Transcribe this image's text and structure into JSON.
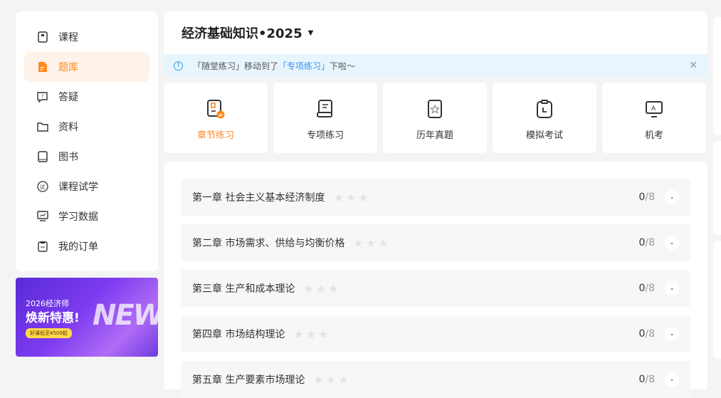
{
  "sidebar": {
    "items": [
      {
        "label": "课程",
        "icon": "book-icon"
      },
      {
        "label": "题库",
        "icon": "document-icon",
        "active": true
      },
      {
        "label": "答疑",
        "icon": "question-chat-icon"
      },
      {
        "label": "资料",
        "icon": "folder-icon"
      },
      {
        "label": "图书",
        "icon": "book-icon"
      },
      {
        "label": "课程试学",
        "icon": "trial-icon"
      },
      {
        "label": "学习数据",
        "icon": "monitor-chart-icon"
      },
      {
        "label": "我的订单",
        "icon": "clipboard-icon"
      }
    ]
  },
  "banner": {
    "line1": "2026经济师",
    "line2": "焕新特惠!",
    "badge": "好课低至¥500起",
    "art": "NEW"
  },
  "header": {
    "title": "经济基础知识•2025"
  },
  "notice": {
    "prefix": "「随堂练习」移动到了",
    "link": "「专项练习」",
    "suffix": "下啦～"
  },
  "tabs": [
    {
      "label": "章节练习",
      "active": true
    },
    {
      "label": "专项练习"
    },
    {
      "label": "历年真题"
    },
    {
      "label": "模拟考试"
    },
    {
      "label": "机考"
    }
  ],
  "chapters": [
    {
      "title": "第一章 社会主义基本经济制度",
      "done": "0",
      "total": "/8",
      "stars": 0
    },
    {
      "title": "第二章 市场需求、供给与均衡价格",
      "done": "0",
      "total": "/8",
      "stars": 0
    },
    {
      "title": "第三章 生产和成本理论",
      "done": "0",
      "total": "/8",
      "stars": 0
    },
    {
      "title": "第四章 市场结构理论",
      "done": "0",
      "total": "/8",
      "stars": 0
    },
    {
      "title": "第五章 生产要素市场理论",
      "done": "0",
      "total": "/8",
      "stars": 0
    }
  ],
  "colors": {
    "accent": "#ff8a1f",
    "link": "#3a8ef0"
  }
}
